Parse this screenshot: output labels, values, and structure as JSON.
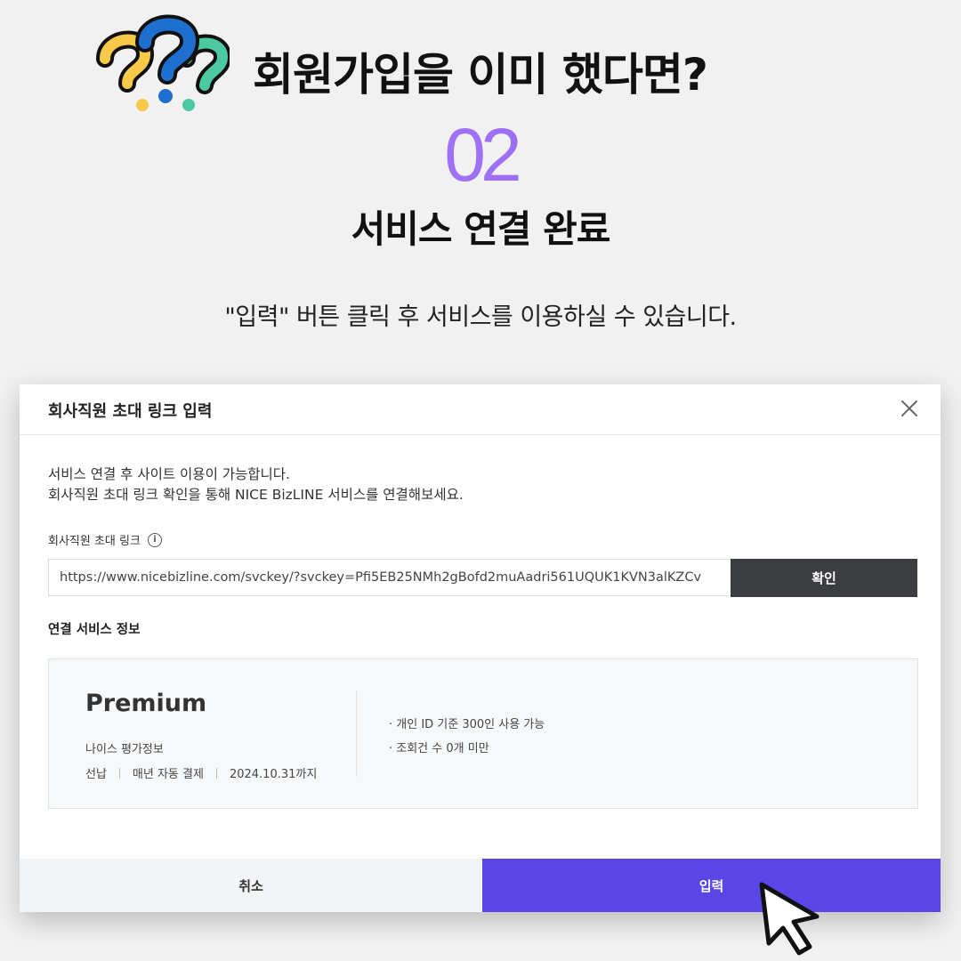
{
  "header": {
    "title": "회원가입을 이미 했다면?",
    "step_number": "02",
    "step_title": "서비스 연결 완료",
    "instruction": "\"입력\" 버튼 클릭 후 서비스를 이용하실 수 있습니다."
  },
  "modal": {
    "title": "회사직원 초대 링크 입력",
    "description_line1": "서비스 연결 후 사이트 이용이 가능합니다.",
    "description_line2": "회사직원 초대 링크 확인을 통해 NICE BizLINE 서비스를 연결해보세요.",
    "field_label": "회사직원 초대 링크",
    "info_glyph": "i",
    "link_value": "https://www.nicebizline.com/svckey/?svckey=Pfi5EB25NMh2gBofd2muAadri561UQUK1KVN3alKZCv",
    "confirm_label": "확인",
    "section_title": "연결 서비스 정보",
    "service": {
      "plan": "Premium",
      "provider": "나이스 평가정보",
      "payment": "선납",
      "billing": "매년 자동 결제",
      "expiry": "2024.10.31까지",
      "feature1": "· 개인 ID 기준 300인 사용 가능",
      "feature2": "· 조회건 수 0개 미만"
    },
    "cancel_label": "취소",
    "submit_label": "입력"
  },
  "colors": {
    "accent": "#5b45e6",
    "confirm_button": "#3b3d40",
    "qmark_yellow": "#f7c948",
    "qmark_blue": "#1f6fd1",
    "qmark_green": "#4cc9a0"
  },
  "icons": [
    "question-marks-icon",
    "close-icon",
    "info-icon",
    "mouse-cursor-icon"
  ]
}
